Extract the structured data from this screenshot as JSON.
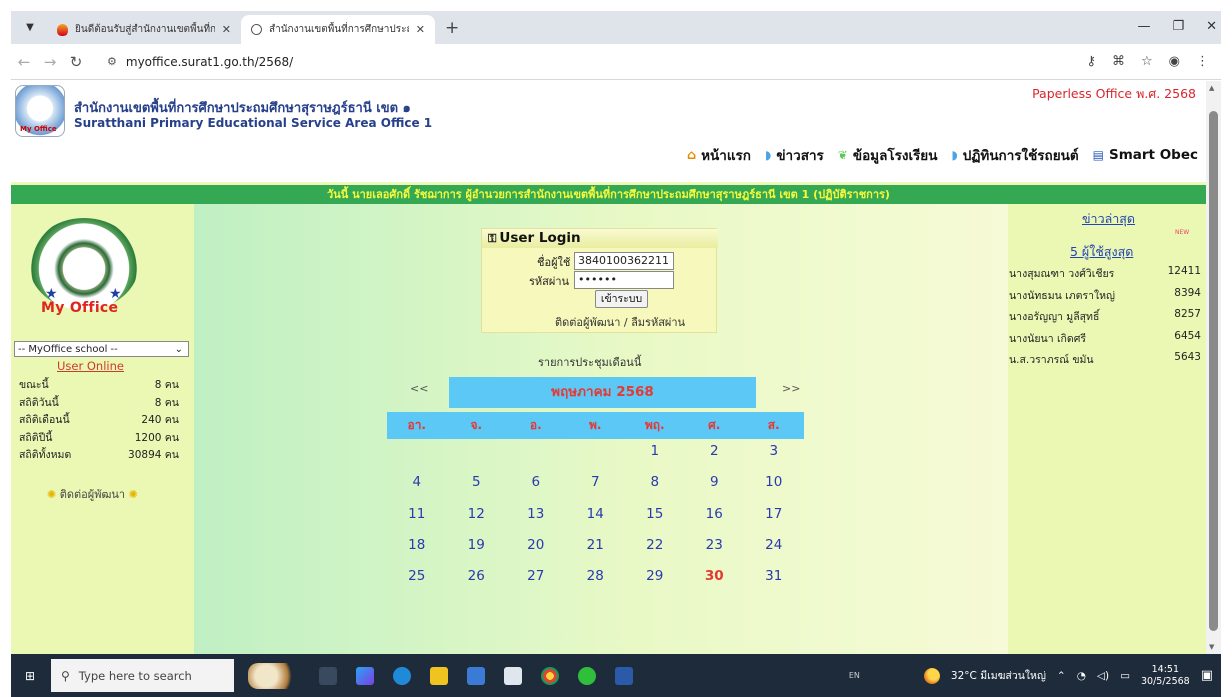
{
  "browser": {
    "tabs": [
      {
        "title": "ยินดีต้อนรับสู่สำนักงานเขตพื้นที่การศึ",
        "active": false
      },
      {
        "title": "สำนักงานเขตพื้นที่การศึกษาประถมศึ",
        "active": true
      }
    ],
    "url": "myoffice.surat1.go.th/2568/"
  },
  "header": {
    "org_name_th": "สำนักงานเขตพื้นที่การศึกษาประถมศึกษาสุราษฎร์ธานี เขต ๑",
    "org_name_en": "Suratthani Primary Educational Service Area Office 1",
    "logo_text": "My Office",
    "paperless": "Paperless Office พ.ศ. 2568",
    "nav": [
      {
        "label": "หน้าแรก",
        "icon": "home-icon"
      },
      {
        "label": "ข่าวสาร",
        "icon": "page-icon"
      },
      {
        "label": "ข้อมูลโรงเรียน",
        "icon": "school-icon"
      },
      {
        "label": "ปฏิทินการใช้รถยนต์",
        "icon": "page-icon"
      },
      {
        "label": "Smart Obec",
        "icon": "document-icon"
      }
    ]
  },
  "banner": "วันนี้ นายเลอศักดิ์ รัชฌาการ ผู้อำนวยการสำนักงานเขตพื้นที่การศึกษาประถมศึกษาสุราษฎร์ธานี เขต 1 (ปฏิบัติราชการ)",
  "left": {
    "logo_text": "My Office",
    "school_select": "-- MyOffice school --",
    "user_online_title": "User Online",
    "stats": [
      {
        "label": "ขณะนี้",
        "value": "8 คน"
      },
      {
        "label": "สถิติวันนี้",
        "value": "8 คน"
      },
      {
        "label": "สถิติเดือนนี้",
        "value": "240 คน"
      },
      {
        "label": "สถิติปีนี้",
        "value": "1200 คน"
      },
      {
        "label": "สถิติทั้งหมด",
        "value": "30894 คน"
      }
    ],
    "contact_dev": "ติดต่อผู้พัฒนา"
  },
  "login": {
    "title": "User Login",
    "username_label": "ชื่อผู้ใช้",
    "username_value": "3840100362211",
    "password_label": "รหัสผ่าน",
    "password_value": "••••••",
    "submit_label": "เข้าระบบ",
    "links": "ติดต่อผู้พัฒนา / ลืมรหัสผ่าน"
  },
  "calendar": {
    "heading": "รายการประชุมเดือนนี้",
    "prev": "<<",
    "next": ">>",
    "month": "พฤษภาคม 2568",
    "days_of_week": [
      "อา.",
      "จ.",
      "อ.",
      "พ.",
      "พฤ.",
      "ศ.",
      "ส."
    ],
    "weeks": [
      [
        "",
        "",
        "",
        "",
        "1",
        "2",
        "3"
      ],
      [
        "4",
        "5",
        "6",
        "7",
        "8",
        "9",
        "10"
      ],
      [
        "11",
        "12",
        "13",
        "14",
        "15",
        "16",
        "17"
      ],
      [
        "18",
        "19",
        "20",
        "21",
        "22",
        "23",
        "24"
      ],
      [
        "25",
        "26",
        "27",
        "28",
        "29",
        "30",
        "31"
      ]
    ],
    "today": "30"
  },
  "right": {
    "news_title": "ข่าวล่าสุด",
    "new_badge": "NEW",
    "top_users_title": "5 ผู้ใช้สูงสุด",
    "top_users": [
      {
        "name": "นางสุมณฑา วงศ์วิเชียร",
        "count": "12411"
      },
      {
        "name": "นางนัทธมน เภตราใหญ่",
        "count": "8394"
      },
      {
        "name": "นางอรัญญา มูลีสุทธิ์",
        "count": "8257"
      },
      {
        "name": "นางนัยนา เกิดศรี",
        "count": "6454"
      },
      {
        "name": "น.ส.วราภรณ์ ขมัน",
        "count": "5643"
      }
    ]
  },
  "taskbar": {
    "search_placeholder": "Type here to search",
    "lang": "EN",
    "weather": "32°C มีเมฆส่วนใหญ่",
    "time": "14:51",
    "date": "30/5/2568"
  }
}
